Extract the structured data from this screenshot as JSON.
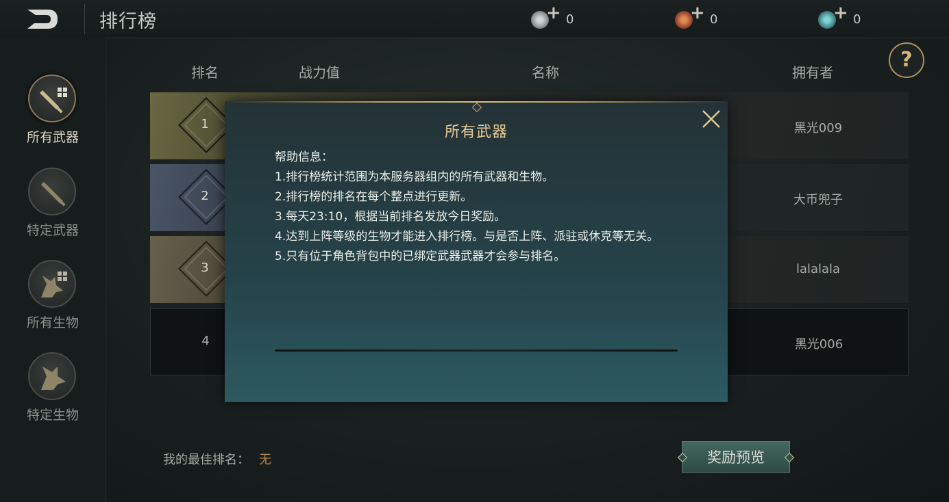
{
  "header": {
    "title": "排行榜",
    "currencies": [
      {
        "icon": "silver-coin-icon",
        "color": "#9aa0a2",
        "value": "0"
      },
      {
        "icon": "red-coin-icon",
        "color": "#b0503a",
        "value": "0"
      },
      {
        "icon": "teal-coin-icon",
        "color": "#3f8c8f",
        "value": "0"
      }
    ]
  },
  "sidebar": {
    "items": [
      {
        "label": "所有武器",
        "icon": "sword-grid-icon",
        "active": true
      },
      {
        "label": "特定武器",
        "icon": "sword-icon",
        "active": false
      },
      {
        "label": "所有生物",
        "icon": "dragon-grid-icon",
        "active": false
      },
      {
        "label": "特定生物",
        "icon": "dragon-icon",
        "active": false
      }
    ]
  },
  "table": {
    "columns": [
      "排名",
      "战力值",
      "名称",
      "拥有者"
    ],
    "rows": [
      {
        "rank": "1",
        "owner": "黑光009"
      },
      {
        "rank": "2",
        "owner": "大币兜子"
      },
      {
        "rank": "3",
        "owner": "lalalala"
      },
      {
        "rank": "4",
        "owner": "黑光006"
      }
    ]
  },
  "footer": {
    "best_rank_label": "我的最佳排名：",
    "best_rank_value": "无",
    "reward_button": "奖励预览"
  },
  "modal": {
    "title": "所有武器",
    "lines": [
      "帮助信息：",
      "1.排行榜统计范围为本服务器组内的所有武器和生物。",
      "2.排行榜的排名在每个整点进行更新。",
      "3.每天23:10，根据当前排名发放今日奖励。",
      "4.达到上阵等级的生物才能进入排行榜。与是否上阵、派驻或休克等无关。",
      "5.只有位于角色背包中的已绑定武器武器才会参与排名。"
    ]
  },
  "colors": {
    "accent_gold": "#d6b57a",
    "button_teal": "#3a5a53"
  }
}
